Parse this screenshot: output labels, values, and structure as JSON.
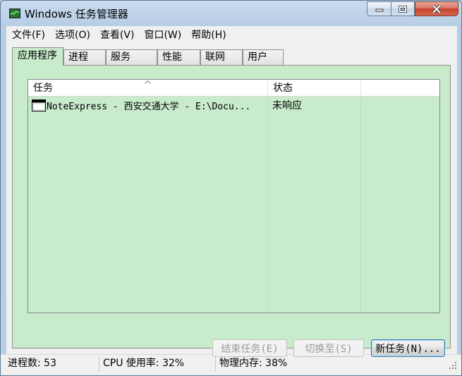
{
  "window": {
    "title": "Windows 任务管理器"
  },
  "menu": [
    "文件(F)",
    "选项(O)",
    "查看(V)",
    "窗口(W)",
    "帮助(H)"
  ],
  "tabs": [
    "应用程序",
    "进程",
    "服务",
    "性能",
    "联网",
    "用户"
  ],
  "active_tab": "应用程序",
  "list": {
    "columns": [
      "任务",
      "状态"
    ],
    "rows": [
      {
        "task": "NoteExpress - 西安交通大学 - E:\\Docu...",
        "status": "未响应"
      }
    ]
  },
  "buttons": {
    "end_task": "结束任务(E)",
    "switch_to": "切换至(S)",
    "new_task": "新任务(N)..."
  },
  "status_bar": {
    "processes": "进程数: 53",
    "cpu": "CPU 使用率: 32%",
    "memory": "物理内存: 38%"
  },
  "colors": {
    "panel_bg": "#c8ebcc",
    "close_button": "#c7432c"
  }
}
